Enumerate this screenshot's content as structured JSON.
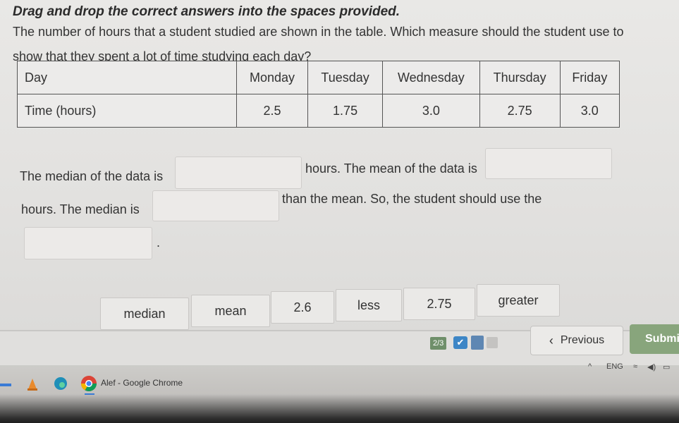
{
  "instruction": "Drag and drop the correct answers into the spaces provided.",
  "question": "The number of hours that a student studied are shown in the table. Which measure should the student use to show that they spent a lot of time studying each day?",
  "table": {
    "header_label": "Day",
    "days": [
      "Monday",
      "Tuesday",
      "Wednesday",
      "Thursday",
      "Friday"
    ],
    "row_label": "Time (hours)",
    "values": [
      "2.5",
      "1.75",
      "3.0",
      "2.75",
      "3.0"
    ]
  },
  "statements": {
    "s1": "The median of the data is",
    "s2": "hours. The mean of the data is",
    "s3": "hours. The median is",
    "s4": "than the mean. So, the student should use the",
    "s5": "."
  },
  "choices": [
    "median",
    "mean",
    "2.6",
    "less",
    "2.75",
    "greater"
  ],
  "footer": {
    "progress": "2/3",
    "previous_label": "Previous",
    "submit_label": "Submit"
  },
  "taskbar": {
    "chrome_label": "Alef - Google Chrome",
    "language": "ENG"
  }
}
